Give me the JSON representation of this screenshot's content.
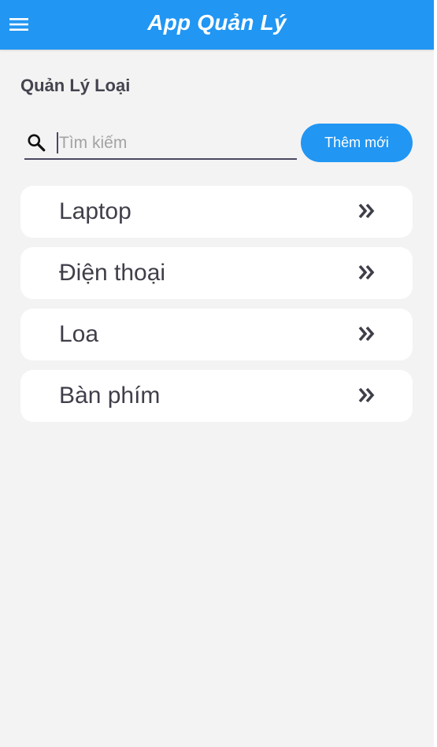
{
  "appbar": {
    "title": "App Quản Lý",
    "menu_icon": "hamburger-menu-icon",
    "background": "#2196f3"
  },
  "page": {
    "section_title": "Quản Lý Loại",
    "background": "#f3f3f3"
  },
  "search": {
    "placeholder": "Tìm kiếm",
    "value": "",
    "icon": "search-icon"
  },
  "add_button": {
    "label": "Thêm mới",
    "color": "#2196f3"
  },
  "categories": [
    {
      "label": "Laptop",
      "icon": "double-chevron-right-icon"
    },
    {
      "label": "Điện thoại",
      "icon": "double-chevron-right-icon"
    },
    {
      "label": "Loa",
      "icon": "double-chevron-right-icon"
    },
    {
      "label": "Bàn phím",
      "icon": "double-chevron-right-icon"
    }
  ]
}
